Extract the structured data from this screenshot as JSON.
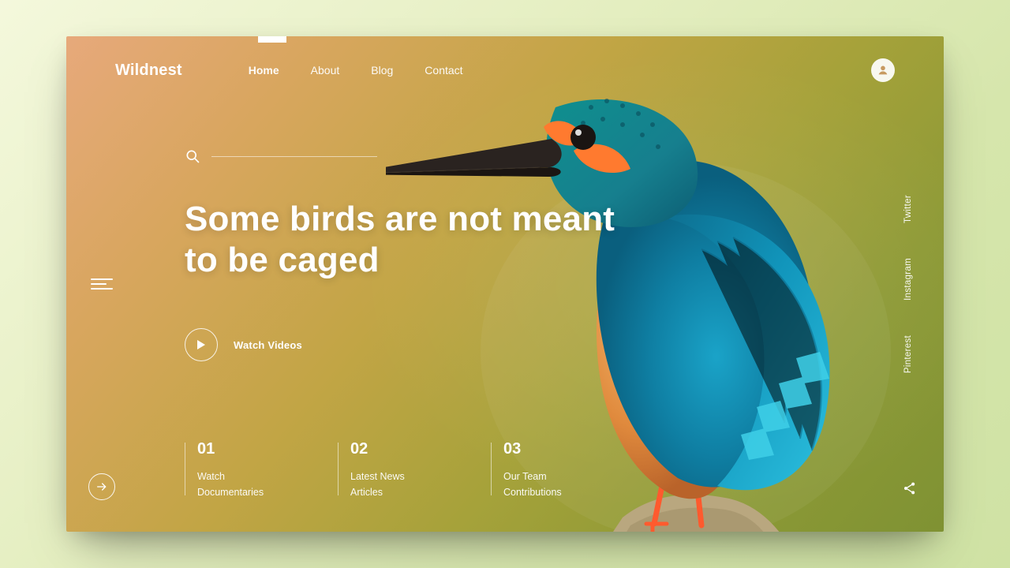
{
  "brand": "Wildnest",
  "nav": {
    "items": [
      {
        "label": "Home",
        "active": true
      },
      {
        "label": "About",
        "active": false
      },
      {
        "label": "Blog",
        "active": false
      },
      {
        "label": "Contact",
        "active": false
      }
    ]
  },
  "search": {
    "placeholder": ""
  },
  "hero": {
    "line1": "Some birds are not meant",
    "line2": "to be caged"
  },
  "watch": {
    "label": "Watch Videos"
  },
  "cards": [
    {
      "num": "01",
      "line1": "Watch",
      "line2": "Documentaries"
    },
    {
      "num": "02",
      "line1": "Latest News",
      "line2": "Articles"
    },
    {
      "num": "03",
      "line1": "Our Team",
      "line2": "Contributions"
    }
  ],
  "social": [
    "Twitter",
    "Instagram",
    "Pinterest"
  ],
  "icons": {
    "menu": "menu-icon",
    "avatar": "avatar-icon",
    "search": "search-icon",
    "play": "play-icon",
    "arrow": "arrow-right-icon",
    "share": "share-icon"
  },
  "colors": {
    "text": "#ffffff",
    "accentWarm": "#e7a97b",
    "accentGreen": "#8e9a36"
  }
}
